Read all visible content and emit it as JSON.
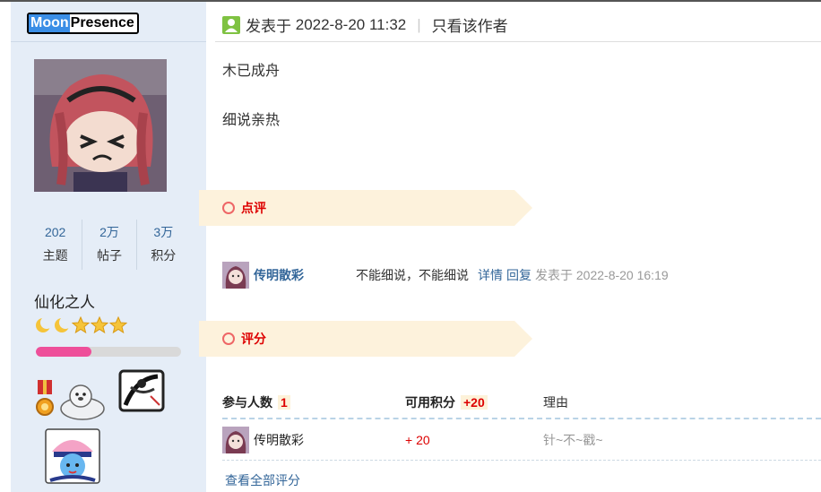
{
  "user": {
    "name_part1": "Moon",
    "name_part2": "Presence",
    "stats": [
      {
        "value": "202",
        "label": "主题"
      },
      {
        "value": "2万",
        "label": "帖子"
      },
      {
        "value": "3万",
        "label": "积分"
      }
    ],
    "rank_title": "仙化之人",
    "rank_progress_percent": 38
  },
  "post": {
    "posted_prefix": "发表于",
    "posted_time": "2022-8-20 11:32",
    "separator": "|",
    "only_author": "只看该作者",
    "content_lines": [
      "木已成舟",
      "细说亲热"
    ]
  },
  "comments_section": {
    "title": "点评",
    "items": [
      {
        "user": "传明散彩",
        "text": "不能细说，不能细说",
        "detail_link": "详情",
        "reply_link": "回复",
        "time": "发表于 2022-8-20 16:19"
      }
    ]
  },
  "rating_section": {
    "title": "评分",
    "header_participants_label": "参与人数",
    "participants_count": "1",
    "header_score_label": "可用积分",
    "score_total": "+20",
    "header_reason_label": "理由",
    "rows": [
      {
        "user": "传明散彩",
        "score": "+ 20",
        "reason": "针~不~戳~"
      }
    ],
    "view_all": "查看全部评分"
  },
  "colors": {
    "sidebar_bg": "#e5edf7",
    "link": "#336699",
    "highlight_red": "#dd0000",
    "ribbon_bg": "#fdf2dc",
    "progress_fill": "#ee4f9a"
  }
}
